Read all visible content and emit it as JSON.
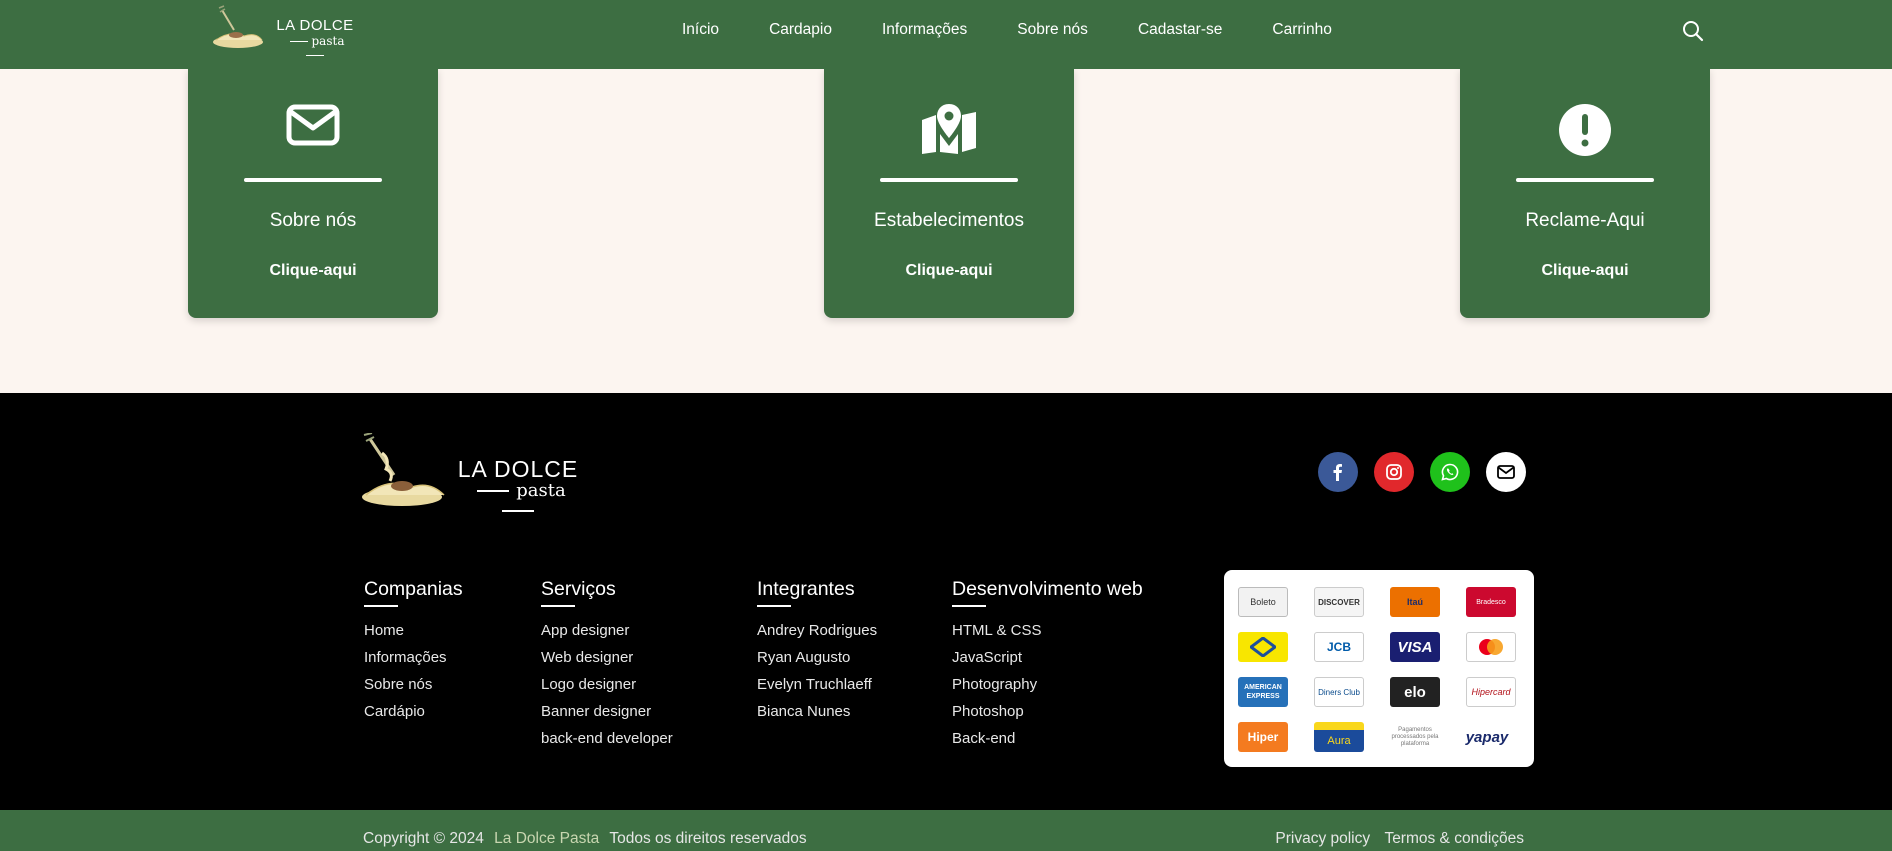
{
  "header": {
    "logo": {
      "title": "LA DOLCE",
      "subtitle": "pasta"
    },
    "nav": [
      "Início",
      "Cardapio",
      "Informações",
      "Sobre nós",
      "Cadastar-se",
      "Carrinho"
    ]
  },
  "cards": [
    {
      "icon": "envelope-icon",
      "title": "Sobre nós",
      "cta": "Clique-aqui"
    },
    {
      "icon": "map-pin-icon",
      "title": "Estabelecimentos",
      "cta": "Clique-aqui"
    },
    {
      "icon": "exclamation-icon",
      "title": "Reclame-Aqui",
      "cta": "Clique-aqui"
    }
  ],
  "footer": {
    "logo": {
      "title": "LA DOLCE",
      "subtitle": "pasta"
    },
    "social": [
      {
        "icon": "facebook-icon",
        "color": "#3b5998"
      },
      {
        "icon": "instagram-icon",
        "color": "#e1282c"
      },
      {
        "icon": "whatsapp-icon",
        "color": "#1fc11b"
      },
      {
        "icon": "envelope-icon",
        "color": "#ffffff"
      }
    ],
    "columns": [
      {
        "title": "Companias",
        "items": [
          "Home",
          "Informações",
          "Sobre nós",
          "Cardápio"
        ]
      },
      {
        "title": "Serviços",
        "items": [
          "App designer",
          "Web designer",
          "Logo designer",
          "Banner designer",
          "back-end developer"
        ]
      },
      {
        "title": "Integrantes",
        "items": [
          "Andrey Rodrigues",
          "Ryan Augusto",
          "Evelyn Truchlaeff",
          "Bianca Nunes"
        ]
      },
      {
        "title": "Desenvolvimento web",
        "items": [
          "HTML & CSS",
          "JavaScript",
          "Photography",
          "Photoshop",
          "Back-end"
        ]
      }
    ],
    "payments": [
      "Boleto",
      "DISCOVER",
      "Itaú",
      "Bradesco",
      "Banco do Brasil",
      "JCB",
      "VISA",
      "mastercard",
      "AMERICAN EXPRESS",
      "Diners Club",
      "elo",
      "Hipercard",
      "Hiper",
      "Aura",
      "Pagamentos processados pela plataforma",
      "yapay"
    ]
  },
  "bottom": {
    "copyright_prefix": "Copyright © 2024",
    "brand": "La Dolce Pasta",
    "copyright_suffix": "Todos os direitos reservados",
    "links": [
      "Privacy policy",
      "Termos & condições"
    ]
  },
  "colors": {
    "primary_green": "#3d6e42",
    "background": "#fcf5f0",
    "footer": "#000000"
  }
}
